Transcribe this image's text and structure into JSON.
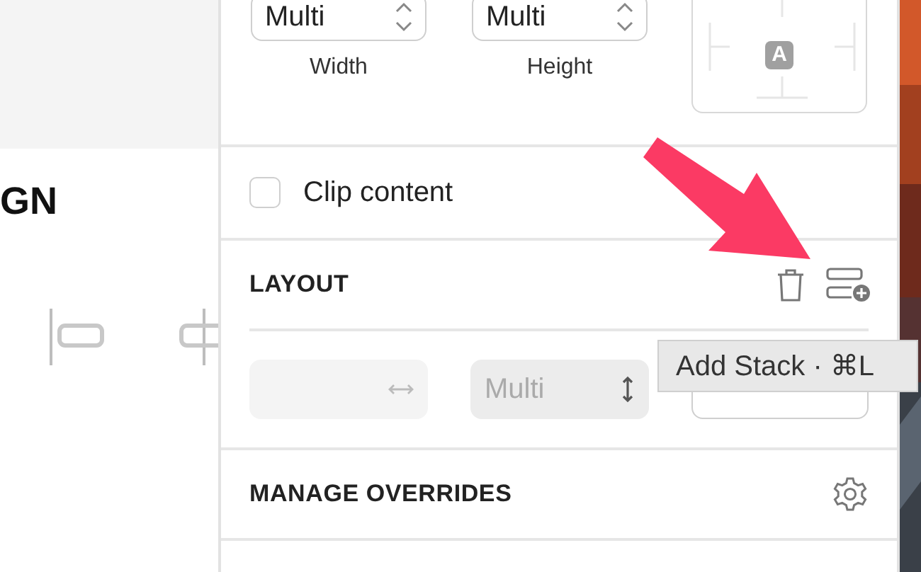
{
  "left_pane": {
    "heading": "GN"
  },
  "size": {
    "fields": [
      {
        "value": "Multi",
        "label": "Width"
      },
      {
        "value": "Multi",
        "label": "Height"
      }
    ],
    "anchor_label": "A"
  },
  "clip_content": {
    "label": "Clip content",
    "checked": false
  },
  "layout": {
    "title": "LAYOUT"
  },
  "layout_fields": [
    {
      "kind": "horizontal",
      "disabled": true
    },
    {
      "kind": "vertical",
      "value": "Multi",
      "disabled": true
    },
    {
      "kind": "button"
    }
  ],
  "manage_overrides": {
    "title": "MANAGE OVERRIDES"
  },
  "tooltip": {
    "text": "Add Stack · ⌘L"
  }
}
